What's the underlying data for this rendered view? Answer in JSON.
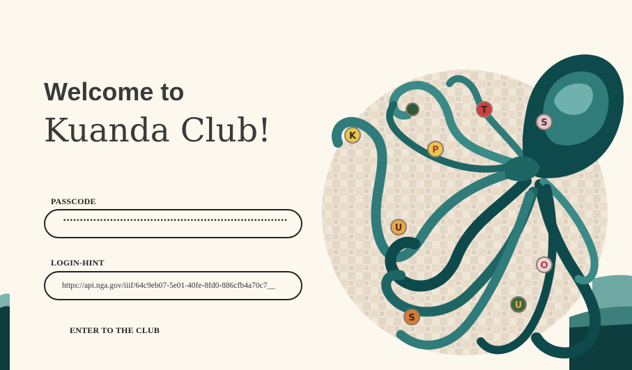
{
  "welcome": {
    "line1": "Welcome to",
    "line2": "Kuanda Club!"
  },
  "passcode": {
    "label": "PASSCODE",
    "value": "••••••••••••••••••••••••••••••••••••••••••••••••••••••••••••••••••••••••••••••••••••••"
  },
  "login_hint": {
    "label": "LOGIN-HINT",
    "value": "https://api.nga.gov/iiif/64c9eb07-5e01-40fe-8fd0-886cfb4a70c7__"
  },
  "enter_button": {
    "label": "ENTER TO THE CLUB"
  },
  "letter_badges": [
    "K",
    "P",
    "T",
    "S",
    "U",
    "O",
    "U",
    "S"
  ],
  "colors": {
    "background": "#fdf8ee",
    "teal_dark": "#0e4a4b",
    "teal_mid": "#2e7a78",
    "teal_light": "#6fb1ad",
    "text": "#3a3a3a"
  }
}
